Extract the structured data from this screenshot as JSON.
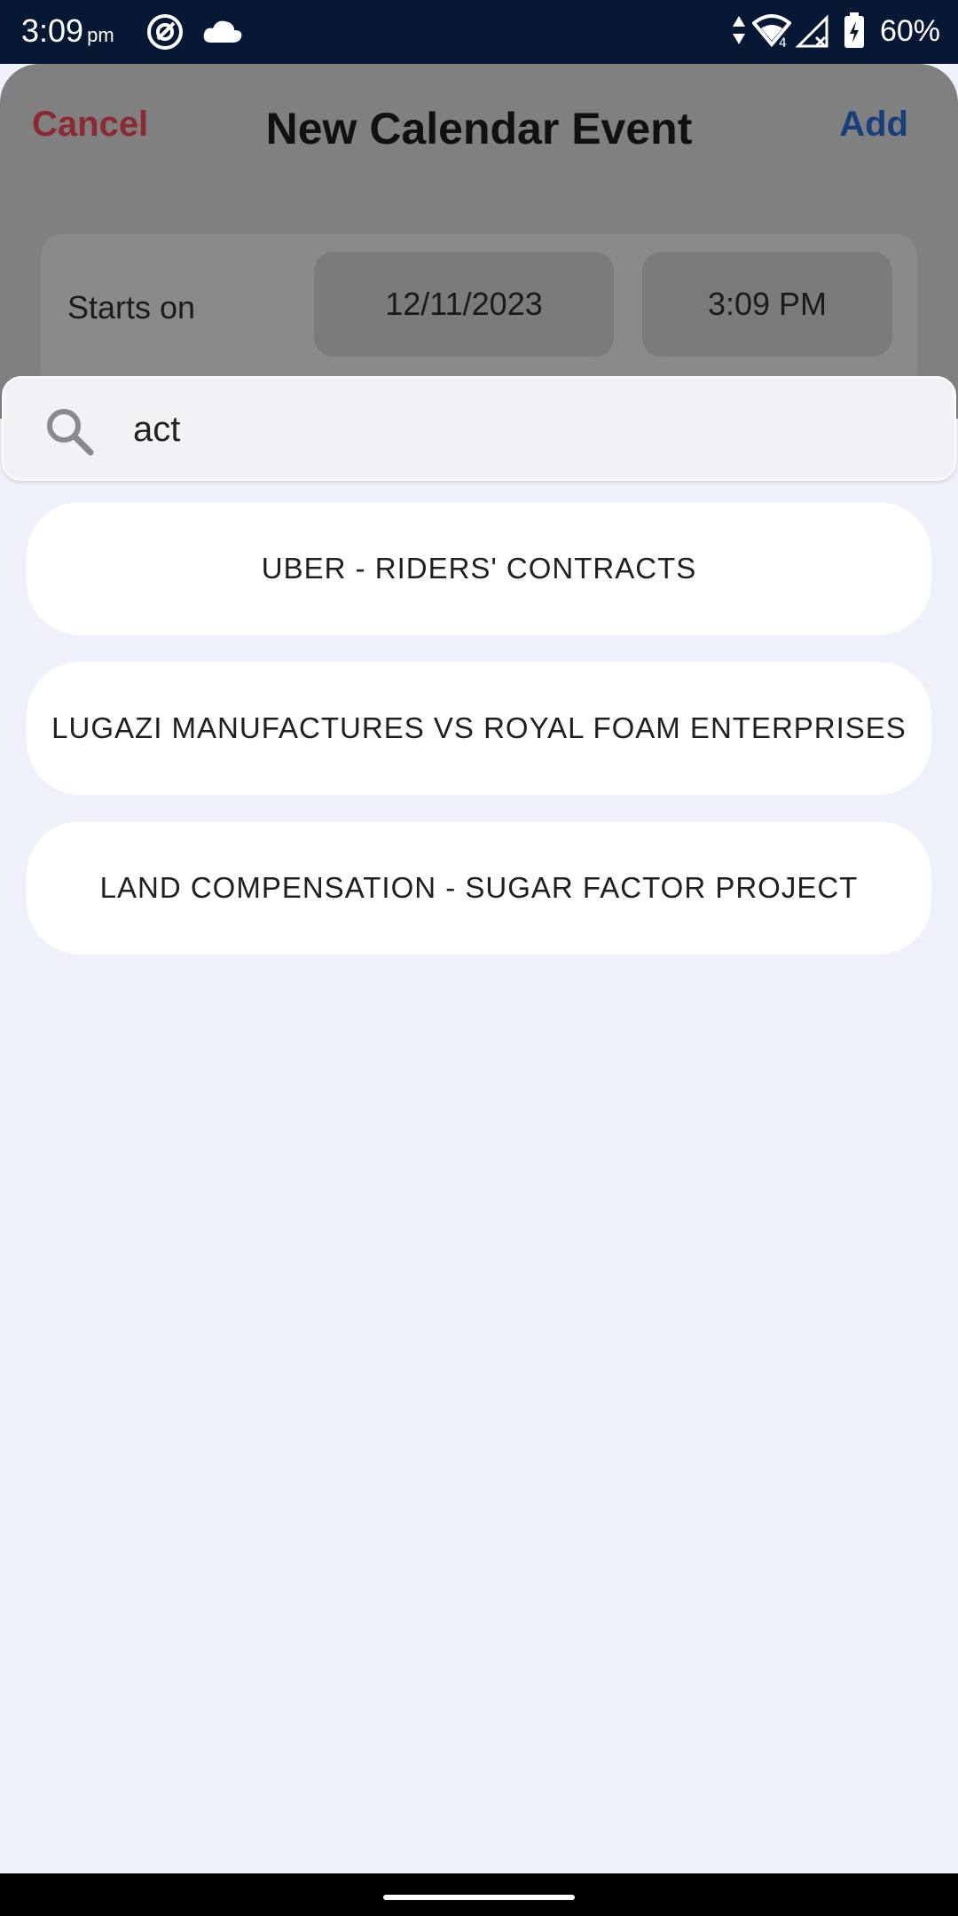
{
  "status_bar": {
    "time": "3:09",
    "ampm": "pm",
    "battery": "60%",
    "icons": [
      "at-sign-icon",
      "cloud-icon",
      "data-arrows-icon",
      "wifi-icon",
      "no-signal-icon",
      "battery-charging-icon"
    ]
  },
  "header": {
    "cancel_label": "Cancel",
    "title": "New Calendar Event",
    "add_label": "Add"
  },
  "starts": {
    "label": "Starts on",
    "date": "12/11/2023",
    "time": "3:09 PM"
  },
  "search": {
    "value": "act"
  },
  "results": [
    "UBER - RIDERS' CONTRACTS",
    "LUGAZI MANUFACTURES VS ROYAL FOAM ENTERPRISES",
    "LAND COMPENSATION - SUGAR FACTOR PROJECT"
  ],
  "colors": {
    "status_bar": "#061833",
    "cancel": "#8c2a33",
    "add": "#173f7c",
    "overlay_bg": "#eef1fa"
  }
}
